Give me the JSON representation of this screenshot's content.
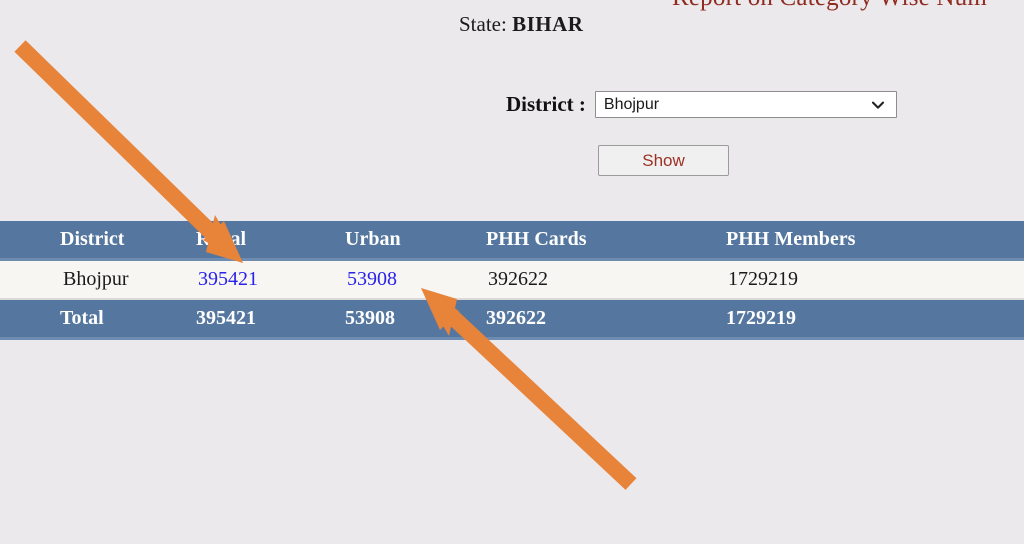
{
  "report": {
    "title": "Report on Category Wise Num",
    "state_label": "State:",
    "state_value": "BIHAR"
  },
  "filters": {
    "district_label": "District :",
    "district_selected": "Bhojpur",
    "district_options": [
      "Bhojpur"
    ],
    "show_button_label": "Show",
    "chevron_icon": "chevron-down-icon"
  },
  "table": {
    "headers": {
      "district": "District",
      "rural": "Rural",
      "urban": "Urban",
      "phh_cards": "PHH Cards",
      "phh_members": "PHH Members"
    },
    "rows": [
      {
        "district": "Bhojpur",
        "rural": "395421",
        "urban": "53908",
        "phh_cards": "392622",
        "phh_members": "1729219"
      }
    ],
    "total": {
      "label": "Total",
      "rural": "395421",
      "urban": "53908",
      "phh_cards": "392622",
      "phh_members": "1729219"
    }
  },
  "annotations": {
    "arrow_1": "arrow-pointing-to-rural-value",
    "arrow_2": "arrow-pointing-to-urban-value",
    "color": "#e8833a"
  },
  "colors": {
    "page_background": "#ebe9ec",
    "table_header_background": "#55779f",
    "table_row_background": "#f7f6f2",
    "link": "#2a22e8",
    "title": "#8f2b20",
    "button_text": "#9c3124",
    "annotation_arrow": "#e8833a"
  }
}
